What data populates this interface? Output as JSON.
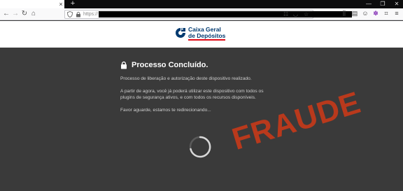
{
  "browser": {
    "tab_close": "×",
    "new_tab": "+",
    "window_controls": [
      "—",
      "❐",
      "✕"
    ],
    "nav": {
      "back": "←",
      "forward": "→",
      "reload": "↻",
      "home": "⌂"
    },
    "url_prefix": "https://",
    "url_icons": {
      "reader": "☷",
      "pocket": "◡",
      "bookmark": "☆"
    },
    "toolbar_icons": [
      "library-icon",
      "sidebar-icon",
      "account-icon",
      "extensions-icon",
      "menu-icon"
    ],
    "toolbar_glyphs": [
      "⫼",
      "▤",
      "☺",
      "✽",
      "≡"
    ]
  },
  "site": {
    "logo_line1": "Caixa Geral",
    "logo_line2": "de Depósitos",
    "brand_colors": {
      "blue": "#003a70",
      "red": "#e00a17"
    }
  },
  "message": {
    "title": "Processo Concluído.",
    "p1": "Processo de liberação e autorização deste dispositivo realizado.",
    "p2_line1": "A partir de agora, você já poderá utilizar este dispositivo com todos os",
    "p2_line2": "plugins de segurança ativos, e com todos os recursos disponíveis.",
    "p3": "Favor aguarde, estamos te redirecionando..."
  },
  "overlay": {
    "stamp": "FRAUDE",
    "stamp_color": "#c0391b"
  },
  "colors": {
    "page_bg": "#3a3a3a",
    "title": "#ffffff",
    "text": "#cfcfcf"
  }
}
